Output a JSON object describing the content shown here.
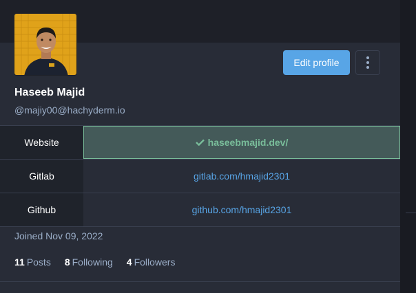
{
  "profile": {
    "display_name": "Haseeb Majid",
    "handle": "@majiy00@hachyderm.io",
    "joined": "Joined Nov 09, 2022"
  },
  "actions": {
    "edit_profile_label": "Edit profile",
    "more_icon": "kebab-vertical-icon"
  },
  "fields": [
    {
      "name": "Website",
      "value": "haseebmajid.dev/",
      "verified": true
    },
    {
      "name": "Gitlab",
      "value": "gitlab.com/hmajid2301",
      "verified": false
    },
    {
      "name": "Github",
      "value": "github.com/hmajid2301",
      "verified": false
    }
  ],
  "stats": {
    "posts_count": "11",
    "posts_label": "Posts",
    "following_count": "8",
    "following_label": "Following",
    "followers_count": "4",
    "followers_label": "Followers"
  },
  "colors": {
    "accent": "#58a5e6",
    "verified": "#79bd9a",
    "background": "#282c37"
  }
}
